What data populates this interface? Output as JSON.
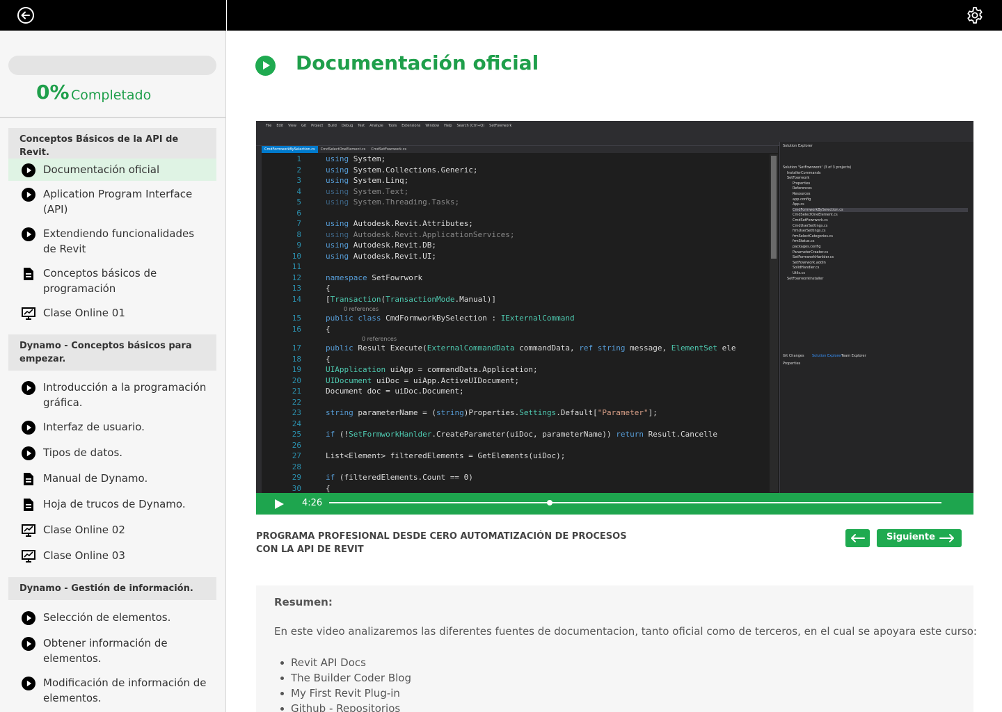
{
  "colors": {
    "accent": "#1faa50",
    "topbar": "#000000",
    "sidebar_bg": "#f6f6f6",
    "active_lesson": "#dff3e4"
  },
  "progress": {
    "percent_label": "0%",
    "completed_label": "Completado",
    "value": 0
  },
  "sections": [
    {
      "title": "Conceptos Básicos de la API de Revit.",
      "lessons": [
        {
          "label": "Documentación oficial",
          "icon": "play-circle-icon",
          "active": true
        },
        {
          "label": "Aplication Program Interface (API)",
          "icon": "play-circle-icon"
        },
        {
          "label": "Extendiendo funcionalidades de Revit",
          "icon": "play-circle-icon"
        },
        {
          "label": "Conceptos básicos de programación",
          "icon": "document-icon"
        },
        {
          "label": "Clase Online 01",
          "icon": "presentation-icon"
        }
      ]
    },
    {
      "title": "Dynamo - Conceptos básicos para empezar.",
      "lessons": [
        {
          "label": "Introducción a la programación gráfica.",
          "icon": "play-circle-icon"
        },
        {
          "label": "Interfaz de usuario.",
          "icon": "play-circle-icon"
        },
        {
          "label": "Tipos de datos.",
          "icon": "play-circle-icon"
        },
        {
          "label": "Manual de Dynamo.",
          "icon": "document-icon"
        },
        {
          "label": "Hoja de trucos de Dynamo.",
          "icon": "document-icon"
        },
        {
          "label": "Clase Online 02",
          "icon": "presentation-icon"
        },
        {
          "label": "Clase Online 03",
          "icon": "presentation-icon"
        }
      ]
    },
    {
      "title": "Dynamo - Gestión de información.",
      "lessons": [
        {
          "label": "Selección de elementos.",
          "icon": "play-circle-icon"
        },
        {
          "label": "Obtener información de elementos.",
          "icon": "play-circle-icon"
        },
        {
          "label": "Modificación de información de elementos.",
          "icon": "play-circle-icon"
        }
      ]
    }
  ],
  "main": {
    "title": "Documentación oficial",
    "course_title": "PROGRAMA PROFESIONAL DESDE CERO AUTOMATIZACIÓN  DE PROCESOS CON  LA API DE REVIT",
    "next_label": "Siguiente",
    "summary_heading": "Resumen:",
    "summary_text": "En este video analizaremos las diferentes fuentes de documentacion, tanto oficial como de terceros, en el cual se apoyara este curso:",
    "summary_items": [
      "Revit API Docs",
      "The Builder Coder Blog",
      "My First Revit Plug-in",
      "Github - Repositorios"
    ]
  },
  "video": {
    "time": "4:26",
    "progress": 0.36,
    "ide_menu": [
      "File",
      "Edit",
      "View",
      "Git",
      "Project",
      "Build",
      "Debug",
      "Test",
      "Analyze",
      "Tools",
      "Extensions",
      "Window",
      "Help",
      "Search (Ctrl+Q)",
      "SetFowrwork"
    ],
    "ide_tabs": [
      "CmdFormworkBySelection.cs",
      "CmdSelectOneElement.cs",
      "CmdSetFowrwork.cs"
    ],
    "code_lines": [
      {
        "n": "1",
        "t": "using System;"
      },
      {
        "n": "2",
        "t": "using System.Collections.Generic;"
      },
      {
        "n": "3",
        "t": "using System.Linq;"
      },
      {
        "n": "4",
        "t": "using System.Text;"
      },
      {
        "n": "5",
        "t": "using System.Threading.Tasks;"
      },
      {
        "n": "6",
        "t": ""
      },
      {
        "n": "7",
        "t": "using Autodesk.Revit.Attributes;"
      },
      {
        "n": "8",
        "t": "using Autodesk.Revit.ApplicationServices;"
      },
      {
        "n": "9",
        "t": "using Autodesk.Revit.DB;"
      },
      {
        "n": "10",
        "t": "using Autodesk.Revit.UI;"
      },
      {
        "n": "11",
        "t": ""
      },
      {
        "n": "12",
        "t": "namespace SetFowrwork"
      },
      {
        "n": "13",
        "t": "{"
      },
      {
        "n": "14",
        "t": "    [Transaction(TransactionMode.Manual)]"
      },
      {
        "n": "15",
        "t": "    public class CmdFormworkBySelection : IExternalCommand"
      },
      {
        "n": "16",
        "t": "    {"
      },
      {
        "n": "17",
        "t": "        public Result Execute(ExternalCommandData commandData, ref string message, ElementSet ele"
      },
      {
        "n": "18",
        "t": "        {"
      },
      {
        "n": "19",
        "t": "            UIApplication uiApp = commandData.Application;"
      },
      {
        "n": "20",
        "t": "            UIDocument uiDoc = uiApp.ActiveUIDocument;"
      },
      {
        "n": "21",
        "t": "            Document doc = uiDoc.Document;"
      },
      {
        "n": "22",
        "t": ""
      },
      {
        "n": "23",
        "t": "            string parameterName = (string)Properties.Settings.Default[\"Parameter\"];"
      },
      {
        "n": "24",
        "t": ""
      },
      {
        "n": "25",
        "t": "            if (!SetFormworkHanlder.CreateParameter(uiDoc, parameterName)) return Result.Cancelle"
      },
      {
        "n": "26",
        "t": ""
      },
      {
        "n": "27",
        "t": "            List<Element> filteredElements = GetElements(uiDoc);"
      },
      {
        "n": "28",
        "t": ""
      },
      {
        "n": "29",
        "t": "            if (filteredElements.Count == 0)"
      },
      {
        "n": "30",
        "t": "            {"
      }
    ],
    "ref_note": "0 references",
    "solution_title": "Solution Explorer",
    "solution_items": [
      "Solution 'SetFowrwork' (3 of 3 projects)",
      "InstallerCommands",
      "SetFowrwork",
      "Properties",
      "References",
      "Resources",
      "app.config",
      "App.cs",
      "CmdFormworkBySelection.cs",
      "CmdSelectOneElement.cs",
      "CmdSetFowrwork.cs",
      "CmdUserSettings.cs",
      "frmUserSettings.cs",
      "frmSelectCategories.cs",
      "frmStatus.cs",
      "packages.config",
      "ParameterCreator.cs",
      "SetFormworkHanlder.cs",
      "SetFowrwork.addin",
      "SolidHandler.cs",
      "Utils.cs",
      "SetFowrworkInstaller"
    ],
    "panel_tabs": [
      "Git Changes",
      "Solution Explorer",
      "Team Explorer"
    ],
    "properties_title": "Properties"
  }
}
